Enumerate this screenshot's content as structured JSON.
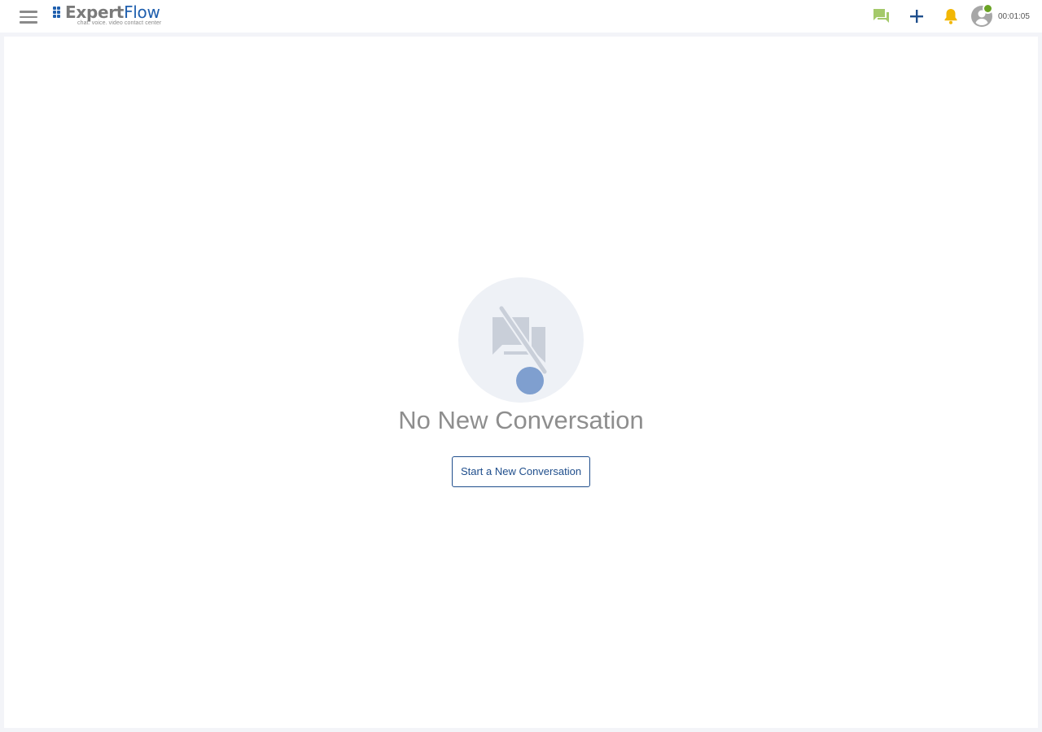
{
  "header": {
    "logo": {
      "name_part1": "Expert",
      "name_part2": "Flow",
      "tagline": "chat. voice. video contact center"
    },
    "icons": [
      "menu-icon",
      "conversations-icon",
      "add-icon",
      "notification-bell-icon",
      "user-avatar-icon"
    ],
    "agent_status": "online",
    "timer": "00:01:05"
  },
  "empty_state": {
    "icon": "no-conversation-icon",
    "title": "No New Conversation",
    "button_label": "Start a New Conversation"
  },
  "colors": {
    "brand_blue": "#1f5fae",
    "button_border": "#1f4e8c",
    "chat_icon_green": "#a4c96a",
    "bell_yellow": "#f2b705",
    "status_green": "#6aa324",
    "illustration_circle": "#eef1f6",
    "illustration_icon": "#c9cfd9",
    "illustration_dot": "#7f9fcf"
  }
}
